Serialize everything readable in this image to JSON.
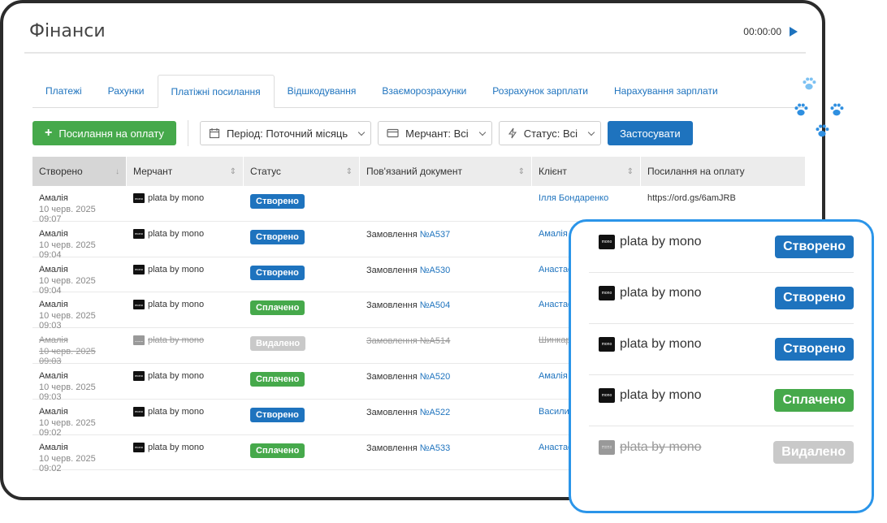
{
  "header": {
    "title": "Фінанси",
    "timer": "00:00:00"
  },
  "tabs": [
    "Платежі",
    "Рахунки",
    "Платіжні посилання",
    "Відшкодування",
    "Взаєморозрахунки",
    "Розрахунок зарплати",
    "Нарахування зарплати"
  ],
  "active_tab": "Платіжні посилання",
  "toolbar": {
    "add_button": "Посилання на оплату",
    "period": "Період: Поточний місяць",
    "merchant": "Мерчант: Всі",
    "status": "Статус: Всі",
    "apply": "Застосувати"
  },
  "columns": [
    "Створено",
    "Мерчант",
    "Статус",
    "Пов'язаний документ",
    "Клієнт",
    "Посилання на оплату"
  ],
  "rows": [
    {
      "name": "Амалія",
      "date": "10 черв. 2025 09:07",
      "merchant": "plata by mono",
      "status": "Створено",
      "doc_prefix": "",
      "doc_ref": "",
      "client": "Ілля Бондаренко",
      "link": "https://ord.gs/6amJRB",
      "deleted": false
    },
    {
      "name": "Амалія",
      "date": "10 черв. 2025 09:04",
      "merchant": "plata by mono",
      "status": "Створено",
      "doc_prefix": "Замовлення",
      "doc_ref": "№A537",
      "client": "Амалія Н",
      "link": "",
      "deleted": false
    },
    {
      "name": "Амалія",
      "date": "10 черв. 2025 09:04",
      "merchant": "plata by mono",
      "status": "Створено",
      "doc_prefix": "Замовлення",
      "doc_ref": "№A530",
      "client": "Анастас",
      "link": "",
      "deleted": false
    },
    {
      "name": "Амалія",
      "date": "10 черв. 2025 09:03",
      "merchant": "plata by mono",
      "status": "Сплачено",
      "doc_prefix": "Замовлення",
      "doc_ref": "№A504",
      "client": "Анастас",
      "link": "",
      "deleted": false
    },
    {
      "name": "Амалія",
      "date": "10 черв. 2025 09:03",
      "merchant": "plata by mono",
      "status": "Видалено",
      "doc_prefix": "Замовлення",
      "doc_ref": "№A514",
      "client": "Шинкар",
      "link": "",
      "deleted": true
    },
    {
      "name": "Амалія",
      "date": "10 черв. 2025 09:03",
      "merchant": "plata by mono",
      "status": "Сплачено",
      "doc_prefix": "Замовлення",
      "doc_ref": "№A520",
      "client": "Амалія Н",
      "link": "",
      "deleted": false
    },
    {
      "name": "Амалія",
      "date": "10 черв. 2025 09:02",
      "merchant": "plata by mono",
      "status": "Створено",
      "doc_prefix": "Замовлення",
      "doc_ref": "№A522",
      "client": "Василиі",
      "link": "",
      "deleted": false
    },
    {
      "name": "Амалія",
      "date": "10 черв. 2025 09:02",
      "merchant": "plata by mono",
      "status": "Сплачено",
      "doc_prefix": "Замовлення",
      "doc_ref": "№A533",
      "client": "Анастас",
      "link": "",
      "deleted": false
    }
  ],
  "zoom_rows": [
    {
      "merchant": "plata by mono",
      "status": "Створено",
      "deleted": false
    },
    {
      "merchant": "plata by mono",
      "status": "Створено",
      "deleted": false
    },
    {
      "merchant": "plata by mono",
      "status": "Створено",
      "deleted": false
    },
    {
      "merchant": "plata by mono",
      "status": "Сплачено",
      "deleted": false
    },
    {
      "merchant": "plata by mono",
      "status": "Видалено",
      "deleted": true
    }
  ],
  "logo_text": "mono",
  "colors": {
    "primary": "#1e73be",
    "success": "#46a94b",
    "muted": "#c9c9c9",
    "zoom_border": "#2b95e9"
  }
}
